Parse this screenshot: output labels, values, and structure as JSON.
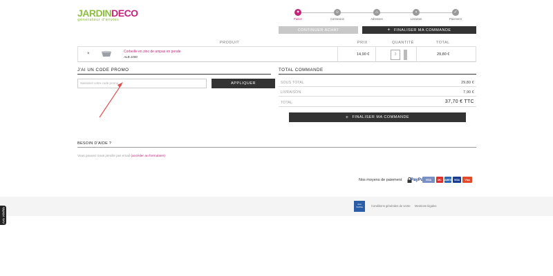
{
  "logo": {
    "part1": "JARDIN",
    "part2": "DECO",
    "tagline": "générateur d'envies"
  },
  "steps": [
    {
      "label": "Panier",
      "active": true
    },
    {
      "label": "Connexion",
      "active": false
    },
    {
      "label": "Adresses",
      "active": false
    },
    {
      "label": "Livraison",
      "active": false
    },
    {
      "label": "Paiement",
      "active": false
    }
  ],
  "buttons": {
    "continue_label": "CONTINUER ACHAT",
    "finish_label": "FINALISER MA COMMANDE",
    "apply_label": "APPLIQUER"
  },
  "cart": {
    "headers": {
      "product": "PRODUIT",
      "price": "PRIX",
      "quantity": "QUANTITÉ",
      "total": "TOTAL"
    },
    "item": {
      "remove": "×",
      "name": "Corbeille en zinc de ampas en ponde",
      "ref": "ALB.1000",
      "price": "14,90 €",
      "quantity": "3",
      "total": "29,80 €"
    }
  },
  "promo": {
    "title": "J'AI UN CODE PROMO",
    "placeholder": "Saisissez votre code promo"
  },
  "totals": {
    "title": "TOTAL COMMANDE",
    "rows": [
      {
        "label": "SOUS TOTAL",
        "value": "29,80 €"
      },
      {
        "label": "LIVRAISON",
        "value": "7,90 €"
      },
      {
        "label": "TOTAL",
        "value": "37,70 € TTC"
      }
    ]
  },
  "help": {
    "title": "BESOIN D'AIDE ?",
    "text": "Vous pouvez nous joindre par email ",
    "link": "(accéder au formulaire)"
  },
  "payment": {
    "label": "Nos moyens de paiement",
    "cards": [
      "PayPal",
      "VISA",
      "MC",
      "AMEX",
      "VISA",
      "Visa"
    ]
  },
  "footer": {
    "badge": "Avis Vérifiés",
    "links": [
      "Conditions générales de vente",
      "Mentions légales"
    ]
  },
  "side_tab": "Avis Vérifiés",
  "colors": {
    "brand_green": "#8cbf3f",
    "brand_pink": "#c2257a",
    "dark": "#333333",
    "arrow": "#d9534f"
  }
}
